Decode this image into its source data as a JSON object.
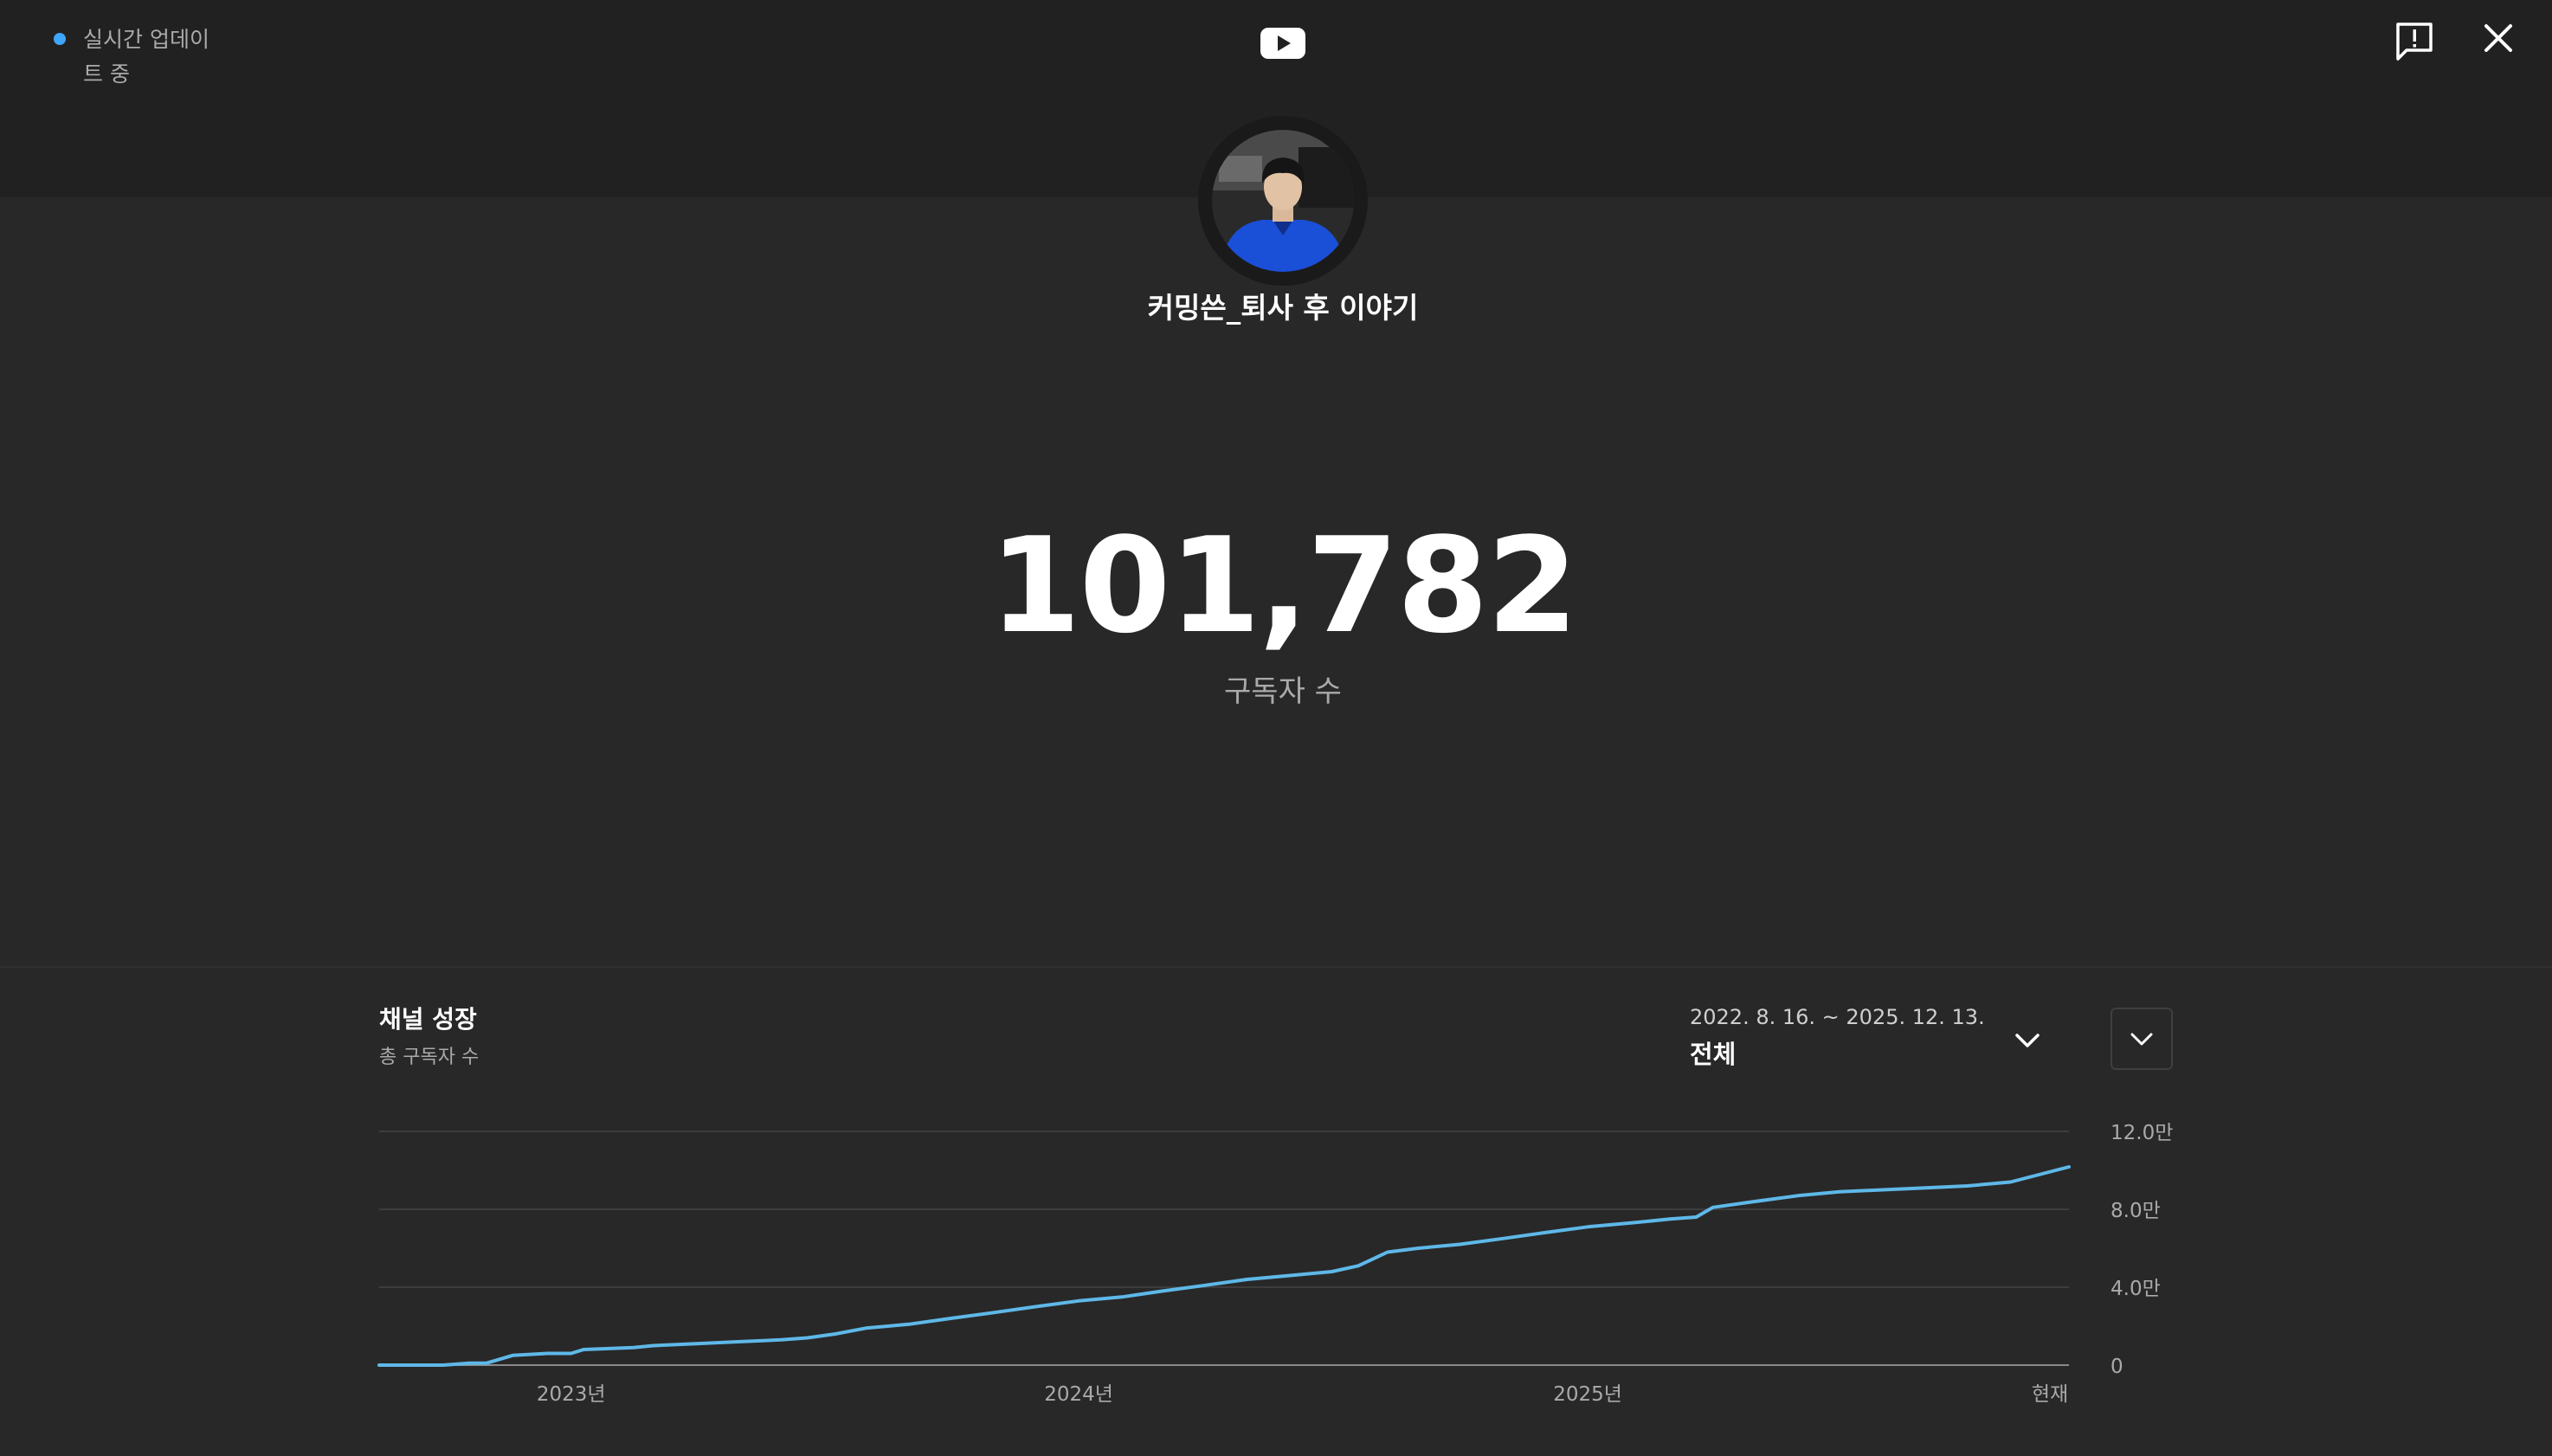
{
  "header": {
    "live_status": "실시간 업데이트 중",
    "icons": [
      "youtube-logo-icon",
      "feedback-icon",
      "close-icon"
    ],
    "accent_color": "#3ea6ff"
  },
  "channel": {
    "name": "커밍쓴_퇴사 후 이야기",
    "subscriber_count": "101,782",
    "subscriber_label": "구독자 수"
  },
  "growth": {
    "title": "채널 성장",
    "subtitle": "총 구독자 수",
    "date_range": "2022. 8. 16. ~ 2025. 12. 13.",
    "range_selected": "전체"
  },
  "chart_data": {
    "type": "line",
    "x_tick_labels": [
      "2023년",
      "2024년",
      "2025년",
      "현재"
    ],
    "y_tick_labels": [
      "12.0만",
      "8.0만",
      "4.0만",
      "0"
    ],
    "ylim": [
      0,
      120000
    ],
    "grid": true,
    "line_color": "#5eb8e8",
    "series": [
      {
        "x": [
          "2022-08-16",
          "2022-10-01",
          "2022-10-20",
          "2022-11-01",
          "2022-11-20",
          "2022-12-15",
          "2023-01-01",
          "2023-01-10",
          "2023-02-15",
          "2023-03-01",
          "2023-04-01",
          "2023-05-01",
          "2023-06-01",
          "2023-06-20",
          "2023-07-10",
          "2023-08-01",
          "2023-09-01",
          "2023-10-01",
          "2023-11-01",
          "2023-12-01",
          "2024-01-01",
          "2024-02-01",
          "2024-03-01",
          "2024-04-01",
          "2024-05-01",
          "2024-06-01",
          "2024-07-01",
          "2024-07-20",
          "2024-08-01",
          "2024-08-10",
          "2024-09-01",
          "2024-10-01",
          "2024-11-01",
          "2024-12-01",
          "2025-01-01",
          "2025-02-01",
          "2025-03-01",
          "2025-03-20",
          "2025-04-01",
          "2025-05-01",
          "2025-06-01",
          "2025-07-01",
          "2025-08-01",
          "2025-09-01",
          "2025-10-01",
          "2025-11-01",
          "2025-12-13"
        ],
        "y": [
          0,
          0,
          1000,
          1000,
          5000,
          6000,
          6000,
          8000,
          9000,
          10000,
          11000,
          12000,
          13000,
          14000,
          16000,
          19000,
          21000,
          24000,
          27000,
          30000,
          33000,
          35000,
          38000,
          41000,
          44000,
          46000,
          48000,
          51000,
          55000,
          58000,
          60000,
          62000,
          65000,
          68000,
          71000,
          73000,
          75000,
          76000,
          81000,
          84000,
          87000,
          89000,
          90000,
          91000,
          92000,
          94000,
          101782
        ]
      }
    ]
  }
}
